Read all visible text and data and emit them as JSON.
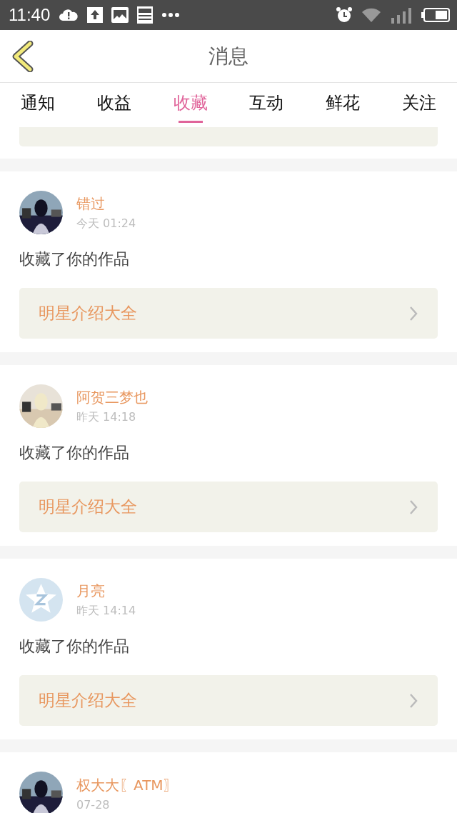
{
  "status_bar": {
    "time": "11:40"
  },
  "header": {
    "title": "消息"
  },
  "tabs": [
    {
      "label": "通知",
      "selected": false
    },
    {
      "label": "收益",
      "selected": false
    },
    {
      "label": "收藏",
      "selected": true
    },
    {
      "label": "互动",
      "selected": false
    },
    {
      "label": "鲜花",
      "selected": false
    },
    {
      "label": "关注",
      "selected": false
    }
  ],
  "messages": [
    {
      "user": "错过",
      "time": "今天 01:24",
      "action": "收藏了你的作品",
      "work": "明星介绍大全"
    },
    {
      "user": "阿贺三梦也",
      "time": "昨天 14:18",
      "action": "收藏了你的作品",
      "work": "明星介绍大全"
    },
    {
      "user": "月亮",
      "time": "昨天 14:14",
      "avatar": {
        "kind": "default"
      },
      "action": "收藏了你的作品",
      "work": "明星介绍大全"
    },
    {
      "user": "权大大〖ATM〗",
      "time": "07-28"
    }
  ]
}
